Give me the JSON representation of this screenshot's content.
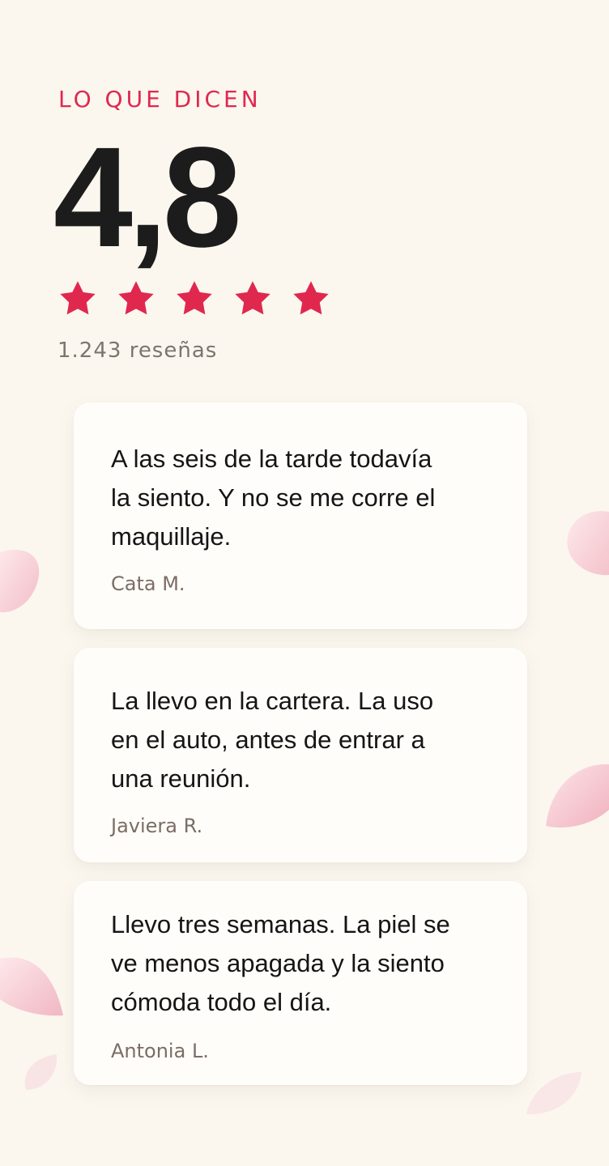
{
  "section_label": "LO QUE DICEN",
  "rating": "4,8",
  "stars": {
    "value": 5,
    "max": 5,
    "color": "#e0284f",
    "icon": "star-icon"
  },
  "review_count": "1.243 reseñas",
  "reviews": [
    {
      "quote": "A las seis de la tarde todavía la siento. Y no se me corre el maquillaje.",
      "author": "Cata M."
    },
    {
      "quote": "La llevo en la cartera. La uso en el auto, antes de entrar a una reunión.",
      "author": "Javiera R."
    },
    {
      "quote": "Llevo tres semanas. La piel se ve menos apagada y la siento cómoda todo el día.",
      "author": "Antonia L."
    }
  ],
  "colors": {
    "background": "#fbf7ef",
    "accent": "#e0284f",
    "card": "#fffdf9",
    "muted_text": "#7b6d65"
  },
  "decorations": {
    "petal_icon": "petal-icon"
  }
}
